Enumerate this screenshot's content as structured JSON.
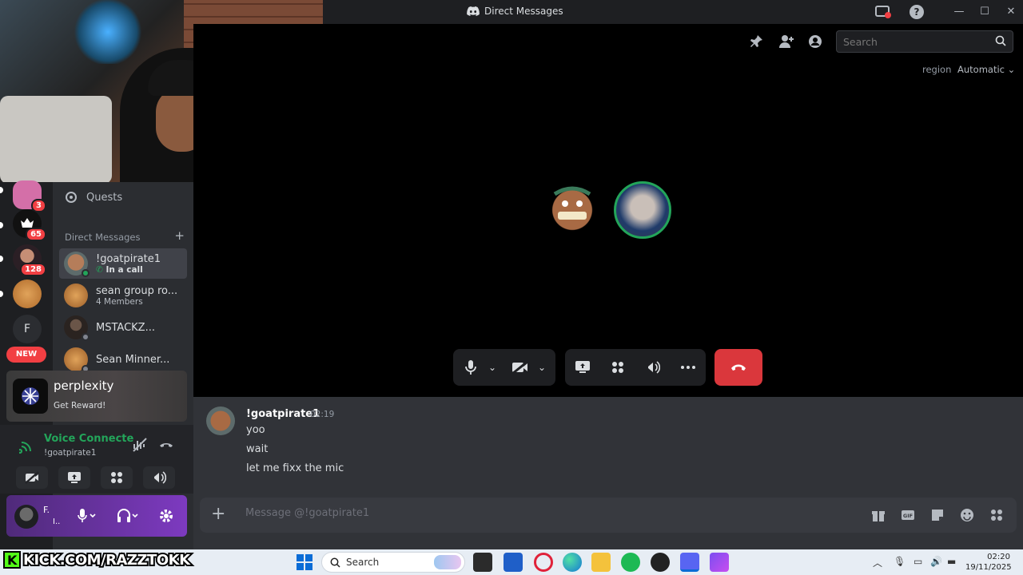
{
  "window": {
    "title": "Direct Messages",
    "minimize": "—",
    "maximize": "☐",
    "close": "✕"
  },
  "colors": {
    "accent": "#5865f2",
    "online": "#23a55a",
    "danger": "#da373c",
    "badge": "#f23f43"
  },
  "guilds": [
    {
      "badge": "3"
    },
    {
      "badge": "65"
    },
    {
      "badge": "128"
    },
    {
      "badge": ""
    },
    {
      "letter": "F"
    }
  ],
  "new_pill": "NEW",
  "sidebar": {
    "quests": "Quests",
    "dm_header": "Direct Messages",
    "dm_add": "+",
    "dms": [
      {
        "name": "!goatpirate1",
        "sub": "In a call",
        "status": "online"
      },
      {
        "name": "sean group ro...",
        "sub": "4 Members",
        "status": ""
      },
      {
        "name": "MSTACKZ...",
        "sub": "",
        "status": "offline"
      },
      {
        "name": "Sean Minner...",
        "sub": "",
        "status": "offline"
      }
    ]
  },
  "promo": {
    "name": "perplexity",
    "sub": "Get Reward!"
  },
  "voice": {
    "status": "Voice Connecte",
    "channel": "!goatpirate1"
  },
  "user": {
    "name": "F.",
    "status": "I.."
  },
  "call": {
    "search_placeholder": "Search",
    "region_label": "region",
    "region_value": "Automatic"
  },
  "chat": {
    "author": "!goatpirate1",
    "time": "02:19",
    "lines": [
      "yoo",
      "wait",
      "let me fixx the mic"
    ],
    "placeholder": "Message @!goatpirate1"
  },
  "overlay": {
    "kick_text": "KICK.COM/RAZZTOKK",
    "kick_letter": "K"
  },
  "taskbar": {
    "search": "Search",
    "time": "02:20",
    "date": "19/11/2025"
  }
}
